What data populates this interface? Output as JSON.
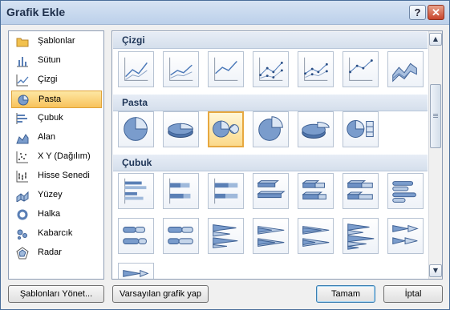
{
  "window": {
    "title": "Grafik Ekle"
  },
  "title_buttons": {
    "help": "?",
    "close": "✕"
  },
  "chart_types": [
    {
      "label": "Şablonlar",
      "icon": "folder-icon",
      "selected": false
    },
    {
      "label": "Sütun",
      "icon": "column-chart-icon",
      "selected": false
    },
    {
      "label": "Çizgi",
      "icon": "line-chart-icon",
      "selected": false
    },
    {
      "label": "Pasta",
      "icon": "pie-chart-icon",
      "selected": true
    },
    {
      "label": "Çubuk",
      "icon": "bar-chart-icon",
      "selected": false
    },
    {
      "label": "Alan",
      "icon": "area-chart-icon",
      "selected": false
    },
    {
      "label": "X Y (Dağılım)",
      "icon": "scatter-chart-icon",
      "selected": false
    },
    {
      "label": "Hisse Senedi",
      "icon": "stock-chart-icon",
      "selected": false
    },
    {
      "label": "Yüzey",
      "icon": "surface-chart-icon",
      "selected": false
    },
    {
      "label": "Halka",
      "icon": "doughnut-chart-icon",
      "selected": false
    },
    {
      "label": "Kabarcık",
      "icon": "bubble-chart-icon",
      "selected": false
    },
    {
      "label": "Radar",
      "icon": "radar-chart-icon",
      "selected": false
    }
  ],
  "sections": {
    "line": {
      "title": "Çizgi",
      "count": 7
    },
    "pie": {
      "title": "Pasta",
      "count": 6,
      "selected_index": 2
    },
    "bar": {
      "title": "Çubuk",
      "count": 15
    }
  },
  "buttons": {
    "manage_templates": "Şablonları Yönet...",
    "set_default": "Varsayılan grafik yap",
    "ok": "Tamam",
    "cancel": "İptal"
  },
  "colors": {
    "accent_blue": "#4a78b8",
    "selection_orange": "#f8c25b"
  }
}
